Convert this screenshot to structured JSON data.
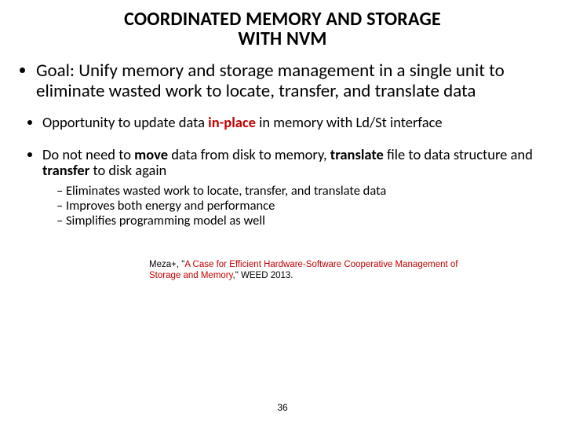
{
  "title_line1": "COORDINATED MEMORY AND STORAGE",
  "title_line2": "WITH NVM",
  "bullets": {
    "goal": "Goal: Unify memory and storage management in a single unit to eliminate wasted work to locate, transfer, and translate data",
    "opp_pre": "Opportunity to update data ",
    "opp_em": "in-place",
    "opp_post": " in memory with Ld/St interface",
    "dnn_1": "Do not need to ",
    "dnn_move": "move",
    "dnn_2": " data from disk to memory, ",
    "dnn_translate": "translate",
    "dnn_3": " file to data structure and ",
    "dnn_transfer": "transfer",
    "dnn_4": " to disk again",
    "dash1": "Eliminates wasted work to locate, transfer, and translate data",
    "dash2": "Improves both energy and performance",
    "dash3": "Simplifies programming model as well"
  },
  "citation": {
    "lead": "Meza+, \"",
    "link": "A Case for Efficient Hardware-Software Cooperative Management of Storage and Memory",
    "tail": ",\" WEED 2013."
  },
  "page_number": "36"
}
